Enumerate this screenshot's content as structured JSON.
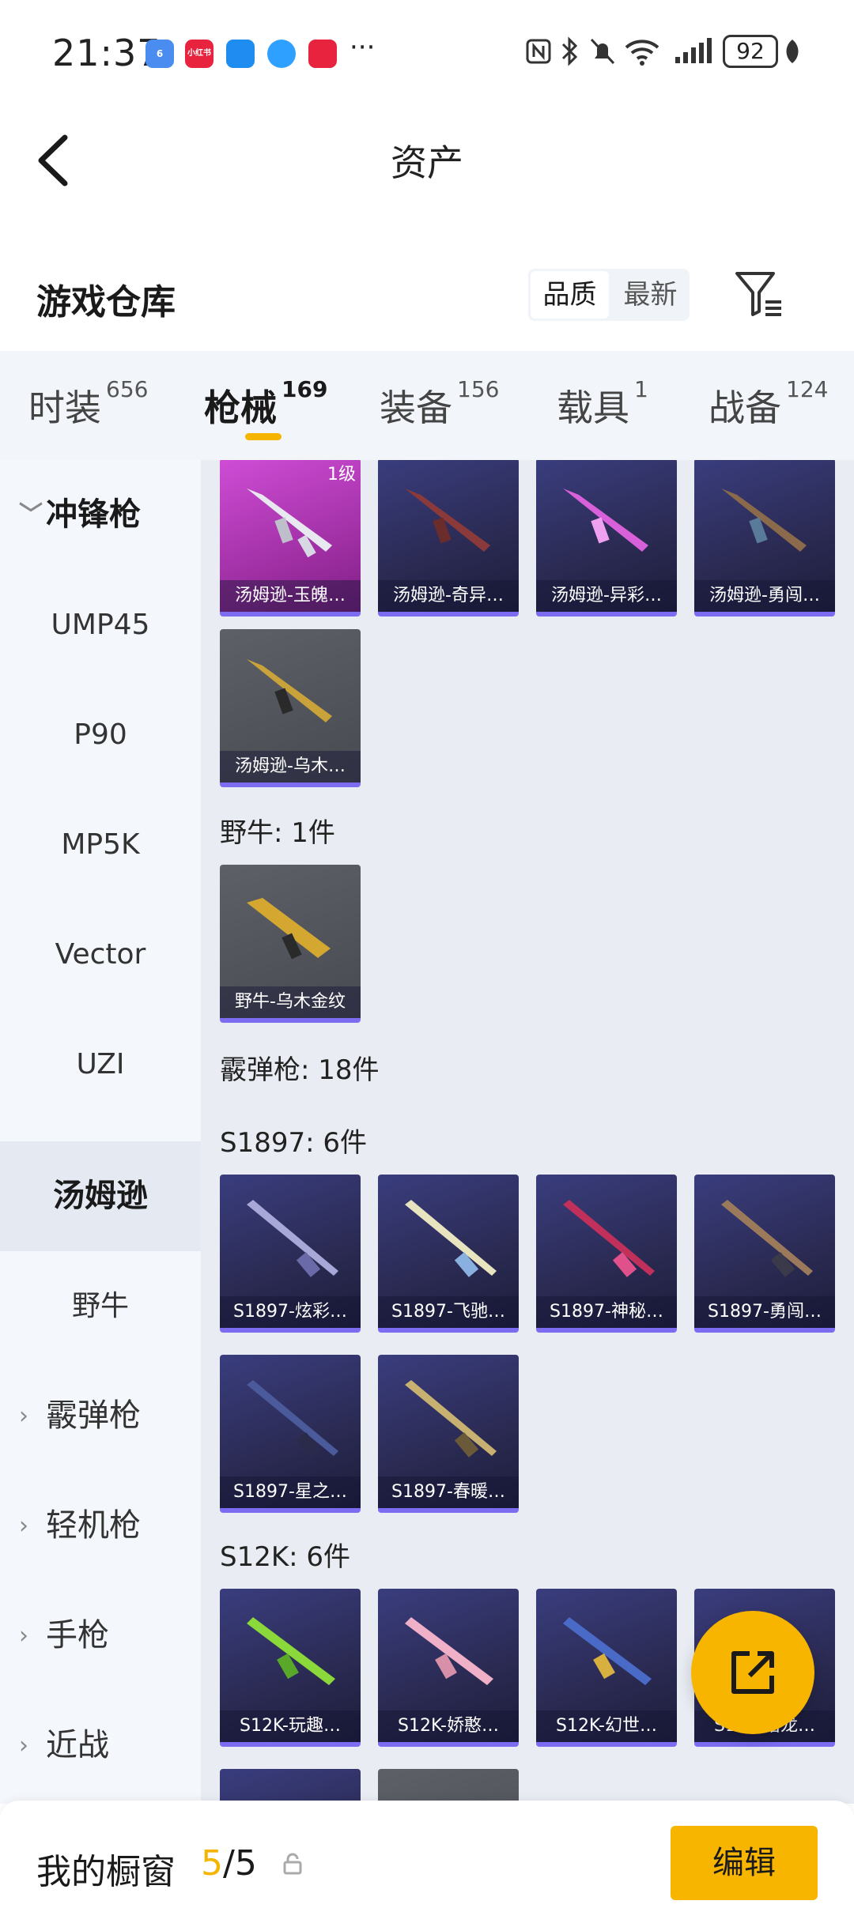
{
  "status_bar": {
    "time": "21:37",
    "apps": [
      "6",
      "小红书",
      "",
      "",
      ""
    ],
    "more": "···",
    "battery": "92"
  },
  "header": {
    "title": "资产"
  },
  "section": {
    "title": "游戏仓库",
    "sort_options": [
      "品质",
      "最新"
    ],
    "sort_active": "品质"
  },
  "tabs": [
    {
      "label": "时装",
      "count": "656"
    },
    {
      "label": "枪械",
      "count": "169",
      "active": true
    },
    {
      "label": "装备",
      "count": "156"
    },
    {
      "label": "载具",
      "count": "1"
    },
    {
      "label": "战备",
      "count": "124"
    }
  ],
  "sidebar": [
    {
      "label": "冲锋枪",
      "type": "parent",
      "expanded": true
    },
    {
      "label": "UMP45"
    },
    {
      "label": "P90"
    },
    {
      "label": "MP5K"
    },
    {
      "label": "Vector"
    },
    {
      "label": "UZI"
    },
    {
      "label": "汤姆逊",
      "selected": true
    },
    {
      "label": "野牛"
    },
    {
      "label": "霰弹枪",
      "type": "parent"
    },
    {
      "label": "轻机枪",
      "type": "parent"
    },
    {
      "label": "手枪",
      "type": "parent"
    },
    {
      "label": "近战",
      "type": "parent"
    }
  ],
  "content": {
    "thompson_cards": [
      {
        "name": "汤姆逊-玉魄…",
        "badge": "1级",
        "style": "pink"
      },
      {
        "name": "汤姆逊-奇异…"
      },
      {
        "name": "汤姆逊-异彩…"
      },
      {
        "name": "汤姆逊-勇闯…"
      },
      {
        "name": "汤姆逊-乌木…",
        "style": "gray"
      }
    ],
    "bizon_label": "野牛: 1件",
    "bizon_cards": [
      {
        "name": "野牛-乌木金纹",
        "style": "gray"
      }
    ],
    "shotgun_label": "霰弹枪: 18件",
    "s1897_label": "S1897: 6件",
    "s1897_cards": [
      {
        "name": "S1897-炫彩…"
      },
      {
        "name": "S1897-飞驰…"
      },
      {
        "name": "S1897-神秘…"
      },
      {
        "name": "S1897-勇闯…"
      },
      {
        "name": "S1897-星之…"
      },
      {
        "name": "S1897-春暖…"
      }
    ],
    "s12k_label": "S12K: 6件",
    "s12k_cards": [
      {
        "name": "S12K-玩趣…"
      },
      {
        "name": "S12K-娇憨…"
      },
      {
        "name": "S12K-幻世…"
      },
      {
        "name": "S12K-猎龙…"
      }
    ]
  },
  "bottom_bar": {
    "label": "我的橱窗",
    "count_current": "5",
    "count_total": "/5",
    "edit_label": "编辑"
  },
  "colors": {
    "accent": "#f8b500",
    "card_purple": "#2e2f5c",
    "card_pink": "#b93ac0",
    "card_border": "#7b6cf2"
  }
}
